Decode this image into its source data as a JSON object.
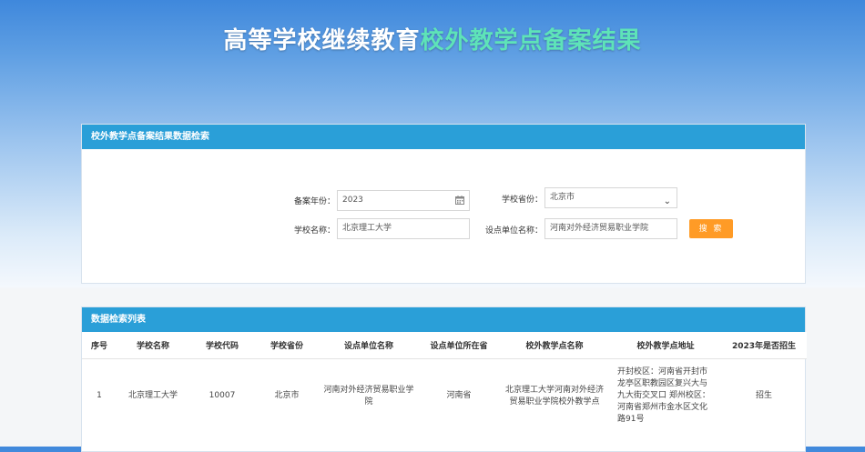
{
  "banner": {
    "title_part1": "高等学校继续教育",
    "title_part2": "校外教学点备案结果"
  },
  "colors": {
    "header_bar": "#2a9fd8",
    "search_button": "#ff9b26",
    "title_highlight": "#5ee3b8"
  },
  "search_panel": {
    "title": "校外教学点备案结果数据检索",
    "year_label": "备案年份：",
    "year_value": "2023",
    "province_label": "学校省份：",
    "province_value": "北京市",
    "school_label": "学校名称：",
    "school_value": "北京理工大学",
    "unit_label": "设点单位名称：",
    "unit_value": "河南对外经济贸易职业学院",
    "search_button": "搜 索"
  },
  "results_panel": {
    "title": "数据检索列表",
    "columns": [
      "序号",
      "学校名称",
      "学校代码",
      "学校省份",
      "设点单位名称",
      "设点单位所在省",
      "校外教学点名称",
      "校外教学点地址",
      "2023年是否招生"
    ],
    "rows": [
      [
        "1",
        "北京理工大学",
        "10007",
        "北京市",
        "河南对外经济贸易职业学院",
        "河南省",
        "北京理工大学河南对外经济贸易职业学院校外教学点",
        "开封校区：河南省开封市龙亭区职教园区复兴大与九大街交叉口 郑州校区：河南省郑州市金水区文化路91号",
        "招生"
      ]
    ]
  }
}
